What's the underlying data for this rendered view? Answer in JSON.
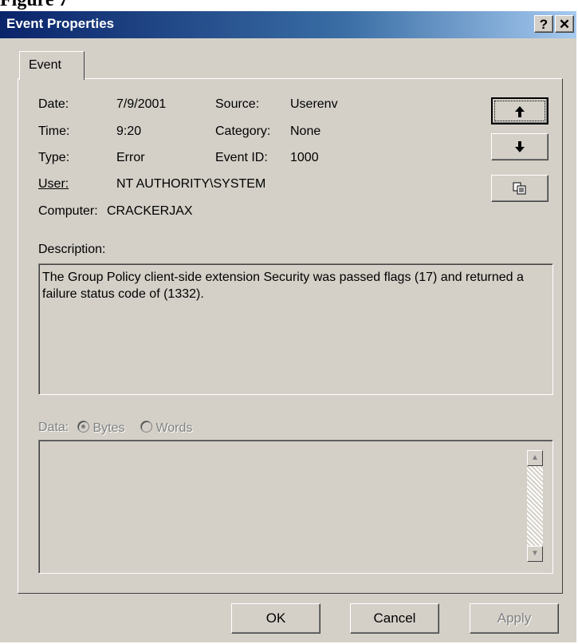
{
  "figure_caption": "Figure 7",
  "window": {
    "title": "Event Properties",
    "help_label": "?",
    "close_label": "✕"
  },
  "tabs": [
    {
      "label": "Event"
    }
  ],
  "fields": {
    "date_label": "Date:",
    "date_value": "7/9/2001",
    "time_label": "Time:",
    "time_value": "9:20",
    "type_label": "Type:",
    "type_value": "Error",
    "user_label": "User:",
    "user_value": "NT AUTHORITY\\SYSTEM",
    "computer_label": "Computer:",
    "computer_value": "CRACKERJAX",
    "source_label": "Source:",
    "source_value": "Userenv",
    "category_label": "Category:",
    "category_value": "None",
    "event_id_label": "Event ID:",
    "event_id_value": "1000"
  },
  "nav": {
    "up_icon": "arrow-up-icon",
    "down_icon": "arrow-down-icon",
    "copy_icon": "copy-icon"
  },
  "description": {
    "label": "Description:",
    "text": "The Group Policy client-side extension Security was passed flags (17) and returned a failure status code of (1332)."
  },
  "data_section": {
    "label": "Data:",
    "options": [
      {
        "label": "Bytes",
        "selected": true
      },
      {
        "label": "Words",
        "selected": false
      }
    ]
  },
  "buttons": {
    "ok": "OK",
    "cancel": "Cancel",
    "apply": "Apply"
  },
  "colors": {
    "face": "#d4d0c8",
    "title_start": "#0a246a",
    "title_end": "#a6caf0",
    "disabled": "#808080"
  }
}
